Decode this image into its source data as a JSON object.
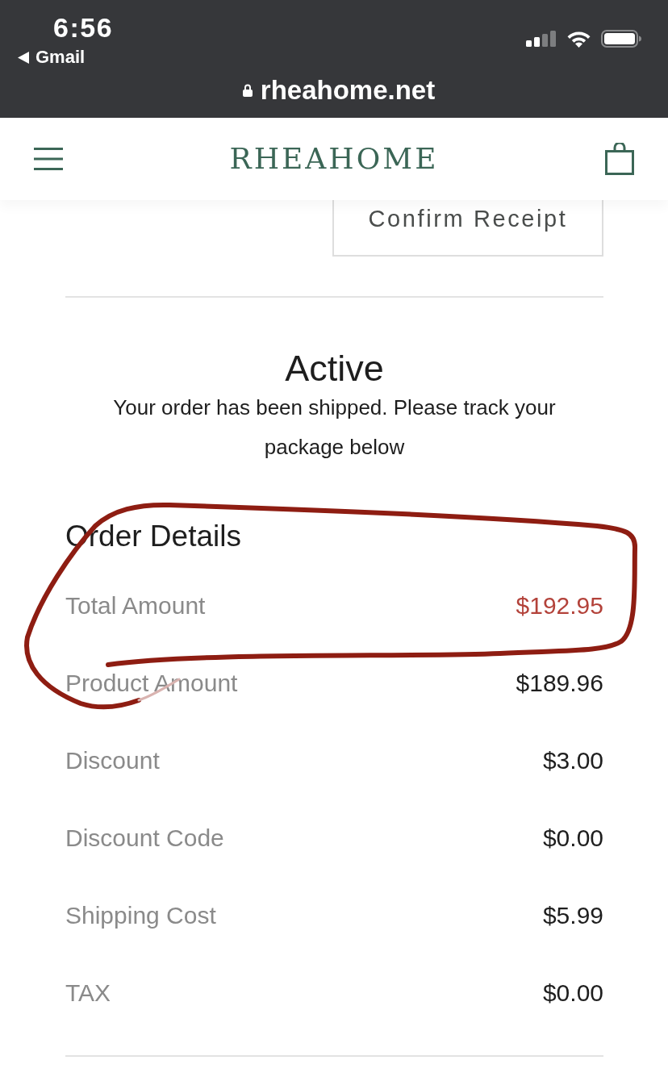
{
  "status_bar": {
    "time": "6:56",
    "back_label": "Gmail",
    "url": "rheahome.net"
  },
  "header": {
    "logo": "RHEAHOME"
  },
  "confirm_button": {
    "label": "Confirm Receipt"
  },
  "order_status": {
    "title": "Active",
    "message": "Your order has been shipped. Please track your package below"
  },
  "order_details": {
    "title": "Order Details",
    "rows": [
      {
        "label": "Total Amount",
        "value": "$192.95",
        "highlighted": true
      },
      {
        "label": "Product Amount",
        "value": "$189.96",
        "highlighted": false
      },
      {
        "label": "Discount",
        "value": "$3.00",
        "highlighted": false
      },
      {
        "label": "Discount Code",
        "value": "$0.00",
        "highlighted": false
      },
      {
        "label": "Shipping Cost",
        "value": "$5.99",
        "highlighted": false
      },
      {
        "label": "TAX",
        "value": "$0.00",
        "highlighted": false
      }
    ]
  }
}
